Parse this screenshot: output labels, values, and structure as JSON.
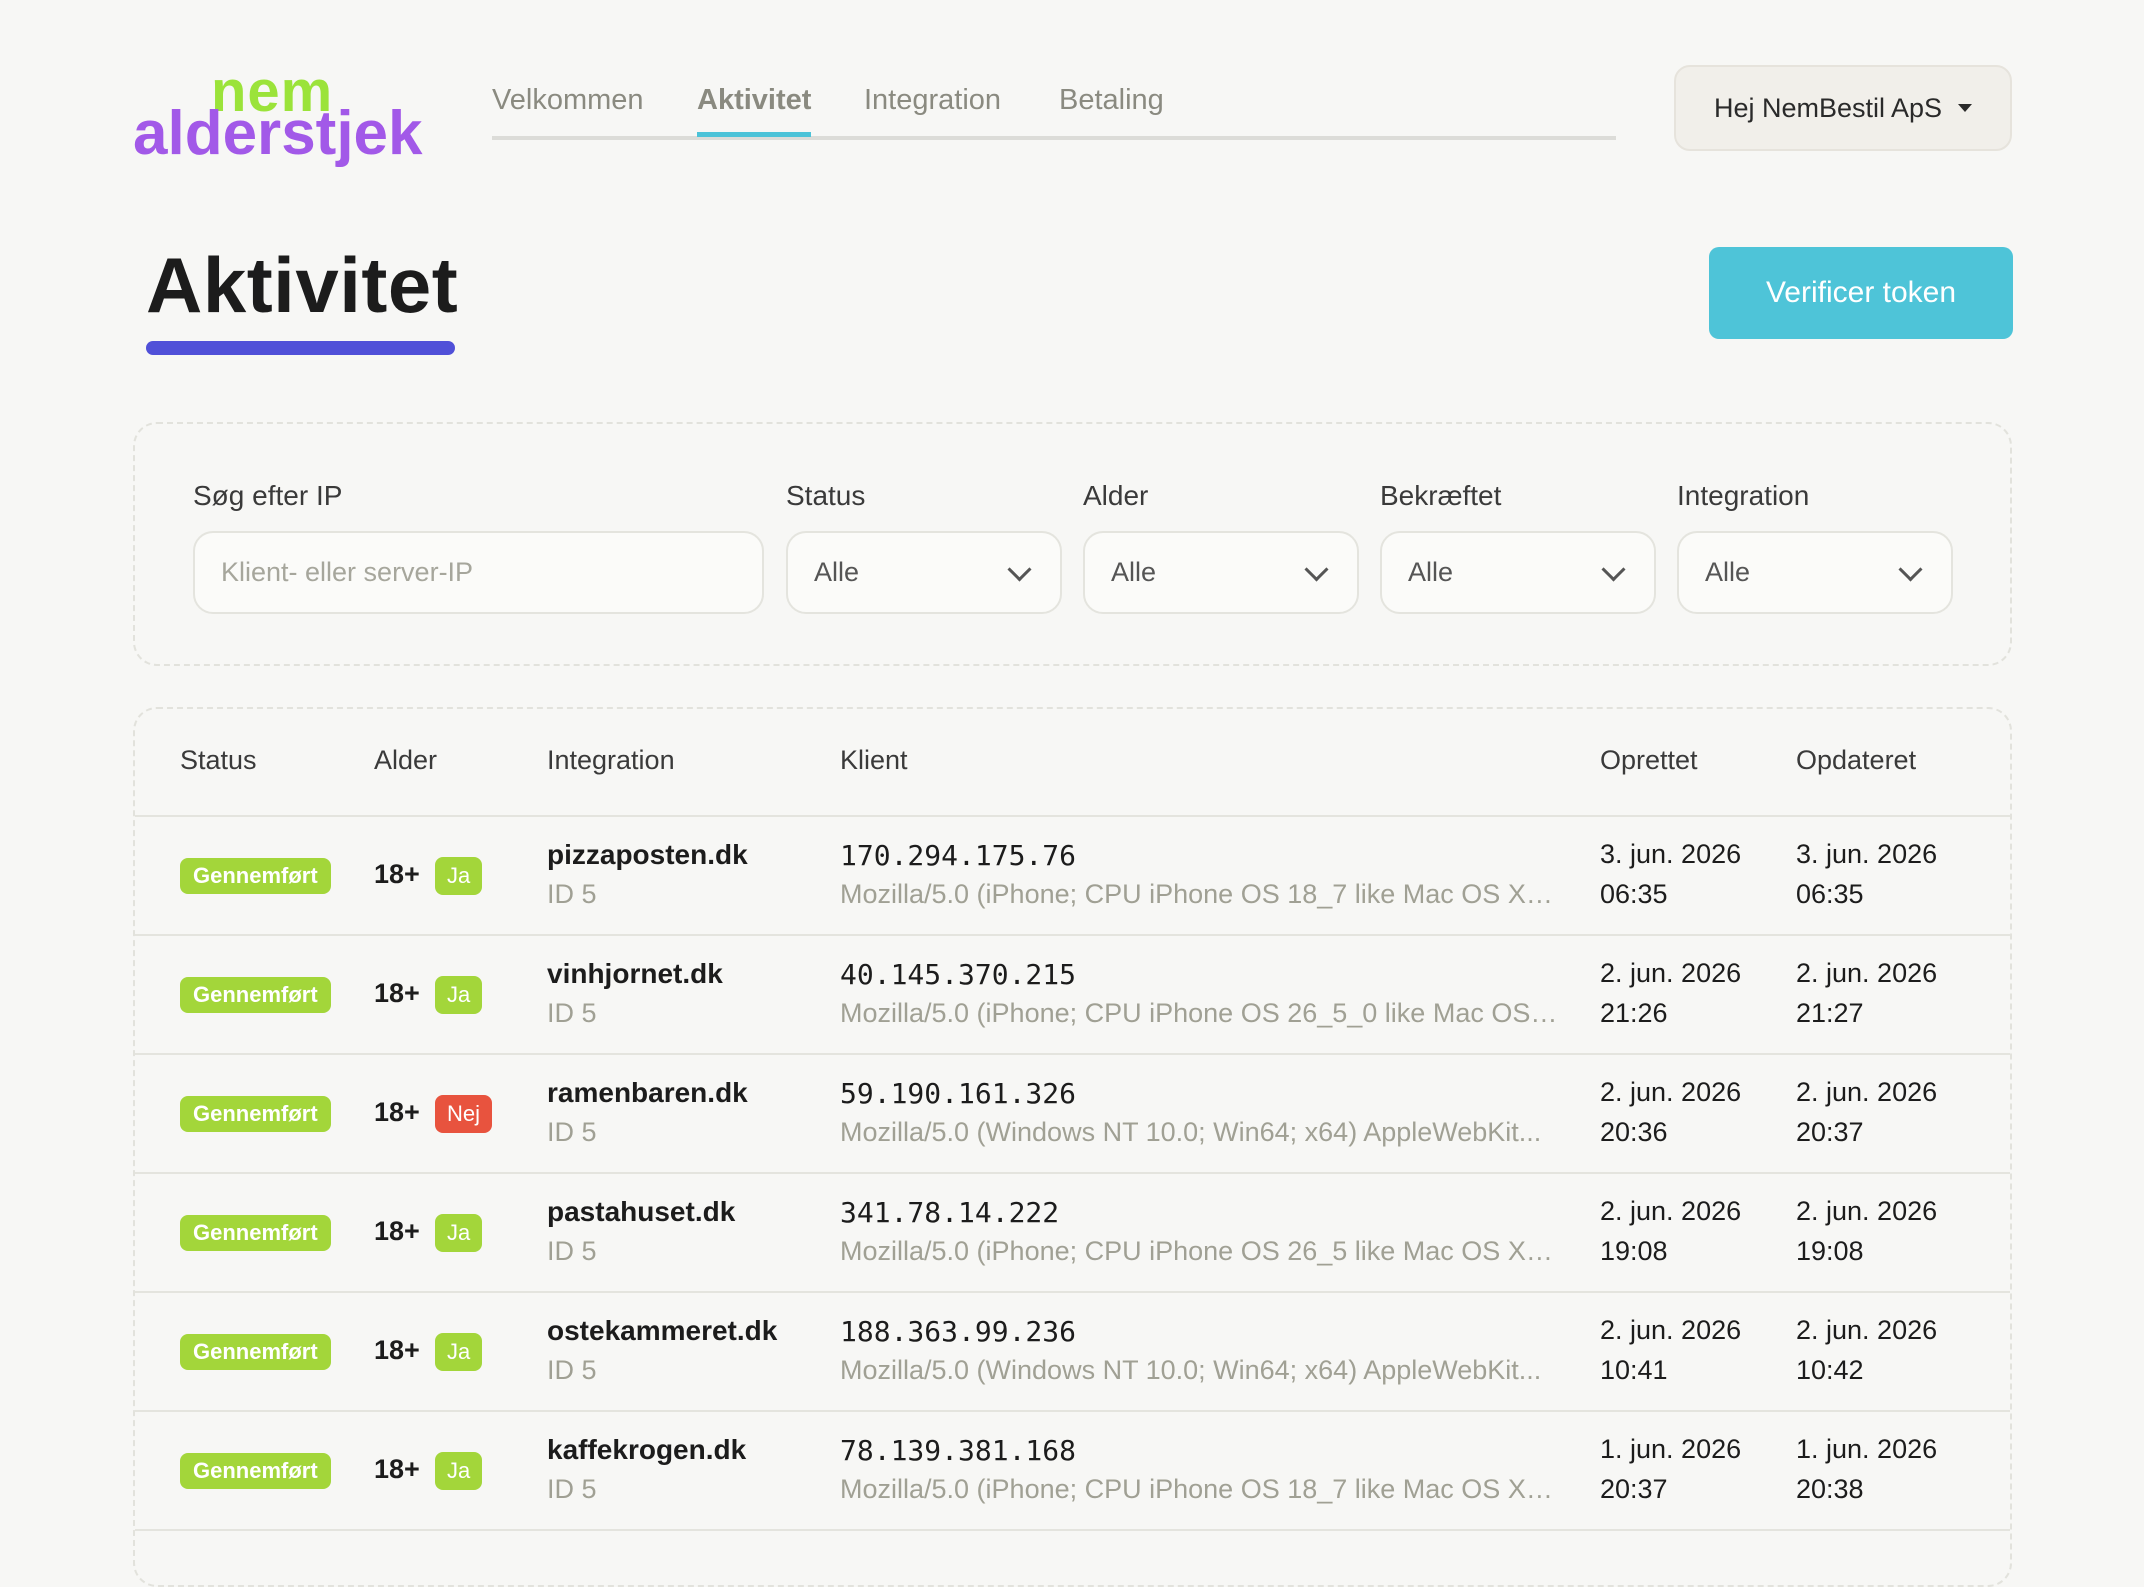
{
  "logo": {
    "top": "nem",
    "bottom": "alderstjek"
  },
  "nav": {
    "tabs": [
      {
        "label": "Velkommen",
        "active": false
      },
      {
        "label": "Aktivitet",
        "active": true
      },
      {
        "label": "Integration",
        "active": false
      },
      {
        "label": "Betaling",
        "active": false
      }
    ]
  },
  "user_menu": {
    "label": "Hej NemBestil ApS"
  },
  "page": {
    "title": "Aktivitet",
    "verify_button": "Verificer token"
  },
  "filters": {
    "search": {
      "label": "Søg efter IP",
      "placeholder": "Klient- eller server-IP"
    },
    "status": {
      "label": "Status",
      "value": "Alle"
    },
    "age": {
      "label": "Alder",
      "value": "Alle"
    },
    "confirmed": {
      "label": "Bekræftet",
      "value": "Alle"
    },
    "integration": {
      "label": "Integration",
      "value": "Alle"
    }
  },
  "table": {
    "columns": [
      "Status",
      "Alder",
      "Integration",
      "Klient",
      "Oprettet",
      "Opdateret"
    ],
    "rows": [
      {
        "status": "Gennemført",
        "age": "18+",
        "confirmed": "Ja",
        "integration": "pizzaposten.dk",
        "integration_id": "ID 5",
        "ip": "170.294.175.76",
        "user_agent": "Mozilla/5.0 (iPhone; CPU iPhone OS 18_7 like Mac OS X) ...",
        "created_date": "3. jun. 2026",
        "created_time": "06:35",
        "updated_date": "3. jun. 2026",
        "updated_time": "06:35"
      },
      {
        "status": "Gennemført",
        "age": "18+",
        "confirmed": "Ja",
        "integration": "vinhjornet.dk",
        "integration_id": "ID 5",
        "ip": "40.145.370.215",
        "user_agent": "Mozilla/5.0 (iPhone; CPU iPhone OS 26_5_0 like Mac OS ...",
        "created_date": "2. jun. 2026",
        "created_time": "21:26",
        "updated_date": "2. jun. 2026",
        "updated_time": "21:27"
      },
      {
        "status": "Gennemført",
        "age": "18+",
        "confirmed": "Nej",
        "integration": "ramenbaren.dk",
        "integration_id": "ID 5",
        "ip": "59.190.161.326",
        "user_agent": "Mozilla/5.0 (Windows NT 10.0; Win64; x64) AppleWebKit...",
        "created_date": "2. jun. 2026",
        "created_time": "20:36",
        "updated_date": "2. jun. 2026",
        "updated_time": "20:37"
      },
      {
        "status": "Gennemført",
        "age": "18+",
        "confirmed": "Ja",
        "integration": "pastahuset.dk",
        "integration_id": "ID 5",
        "ip": "341.78.14.222",
        "user_agent": "Mozilla/5.0 (iPhone; CPU iPhone OS 26_5 like Mac OS X) ...",
        "created_date": "2. jun. 2026",
        "created_time": "19:08",
        "updated_date": "2. jun. 2026",
        "updated_time": "19:08"
      },
      {
        "status": "Gennemført",
        "age": "18+",
        "confirmed": "Ja",
        "integration": "ostekammeret.dk",
        "integration_id": "ID 5",
        "ip": "188.363.99.236",
        "user_agent": "Mozilla/5.0 (Windows NT 10.0; Win64; x64) AppleWebKit...",
        "created_date": "2. jun. 2026",
        "created_time": "10:41",
        "updated_date": "2. jun. 2026",
        "updated_time": "10:42"
      },
      {
        "status": "Gennemført",
        "age": "18+",
        "confirmed": "Ja",
        "integration": "kaffekrogen.dk",
        "integration_id": "ID 5",
        "ip": "78.139.381.168",
        "user_agent": "Mozilla/5.0 (iPhone; CPU iPhone OS 18_7 like Mac OS X) ...",
        "created_date": "1. jun. 2026",
        "created_time": "20:37",
        "updated_date": "1. jun. 2026",
        "updated_time": "20:38"
      }
    ]
  },
  "colors": {
    "accent_teal": "#4ec4d8",
    "title_underline": "#5050d8",
    "status_green": "#a3d63a",
    "status_red": "#e8533e",
    "logo_green": "#9be33a",
    "logo_purple": "#a259e8"
  }
}
